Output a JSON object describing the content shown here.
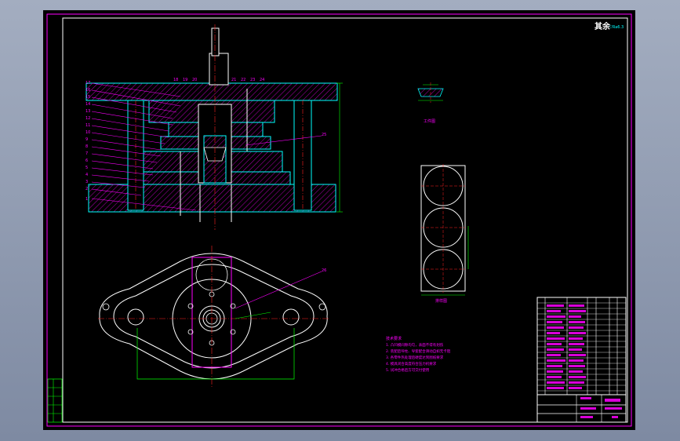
{
  "corner_note": {
    "glyph": "其余",
    "value": "▽Ra6.3"
  },
  "part_labels": [
    "17",
    "16",
    "15",
    "14",
    "13",
    "12",
    "11",
    "10",
    "9",
    "8",
    "7",
    "6",
    "5",
    "4",
    "3",
    "2",
    "1"
  ],
  "top_labels": [
    "18",
    "19",
    "20",
    "21",
    "22",
    "23",
    "24"
  ],
  "callout_25": "25",
  "callout_26": "26",
  "workpiece_label": "工件图",
  "layout_label": "排样图",
  "tech_title": "技术要求",
  "tech_lines": [
    "1. 凸凹模间隙均匀，表面不得有划伤",
    "2. 装配后导柱、导套配合滑动自如无卡阻",
    "3. 各零件热处理后硬度达到图纸要求",
    "4. 模具闭合高度符合压力机要求",
    "5. 试冲合格后方可交付使用"
  ],
  "colors": {
    "frame": "#ff00ff",
    "section": "#00ffff",
    "center": "#ff2020",
    "outline": "#ffffff",
    "dim": "#00ff00",
    "hatch": "#ff00ff"
  }
}
